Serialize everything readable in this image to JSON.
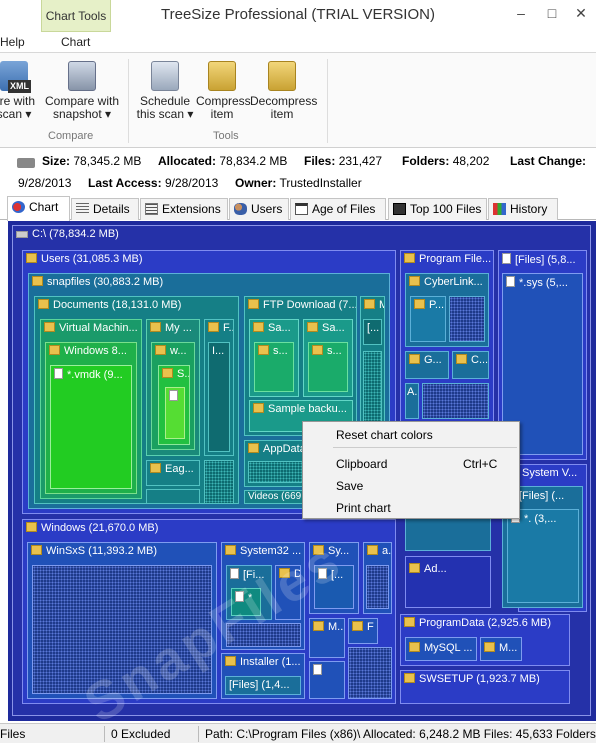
{
  "window": {
    "title": "TreeSize Professional  (TRIAL VERSION)",
    "contextual_tab": "Chart Tools",
    "minimize": "–",
    "maximize": "□",
    "close": "✕"
  },
  "ribbon": {
    "tabs": [
      "Help",
      "Chart"
    ],
    "buttons": {
      "export_xml": "are with\nscan ▾",
      "compare": "Compare with\nsnapshot ▾",
      "schedule": "Schedule\nthis scan ▾",
      "compress": "Compress\nitem",
      "decompress": "Decompress\nitem"
    },
    "groups": {
      "compare": "Compare",
      "tools": "Tools"
    },
    "xml_badge": "XML"
  },
  "info": {
    "size_label": "Size:",
    "size": "78,345.2 MB",
    "allocated_label": "Allocated:",
    "allocated": "78,834.2 MB",
    "files_label": "Files:",
    "files": "231,427",
    "folders_label": "Folders:",
    "folders": "48,202",
    "last_change_label": "Last Change:",
    "last_change": "9/28/2013",
    "last_access_label": "Last Access:",
    "last_access": "9/28/2013",
    "owner_label": "Owner:",
    "owner": "TrustedInstaller"
  },
  "tabs": [
    "Chart",
    "Details",
    "Extensions",
    "Users",
    "Age of Files",
    "Top 100 Files",
    "History"
  ],
  "treemap": {
    "root": "C:\\ (78,834.2 MB)",
    "users": "Users (31,085.3 MB)",
    "snapfiles": "snapfiles (30,883.2 MB)",
    "documents": "Documents (18,131.0 MB)",
    "virtual_machine": "Virtual Machin...",
    "windows8": "Windows 8...",
    "vmdk": "*.vmdk (9...",
    "my": "My ...",
    "w": "w...",
    "s": "S...",
    "f": "F...",
    "i": "I...",
    "eag": "Eag...",
    "ftp": "FTP Download (7...",
    "m1": "M",
    "bracket1": "[...",
    "sa1": "Sa...",
    "sa2": "Sa...",
    "s1": "s...",
    "s2": "s...",
    "sample": "Sample backu...",
    "appdata": "AppData",
    "videos": "Videos (669...",
    "program_files": "Program File...",
    "cyberlink": "CyberLink...",
    "p": "P...",
    "g": "G...",
    "c": "C...",
    "a": "A...",
    "files_top": "[Files] (5,8...",
    "sys": "*.sys (5,...",
    "system_v": "System V...",
    "files_sv": "[Files] (...",
    "star3": "*. (3,...",
    "ad": "Ad...",
    "windows": "Windows (21,670.0 MB)",
    "winsxs": "WinSxS (11,393.2 MB)",
    "system32": "System32 ...",
    "sy": "Sy...",
    "a2": "a...",
    "fi": "[Fi...",
    "d": "D",
    "star": "*",
    "bracket2": "[...",
    "m2": "M...",
    "f2": "F",
    "installer": "Installer (1...",
    "files_inst": "[Files] (1,4...",
    "programdata": "ProgramData (2,925.6 MB)",
    "mysql": "MySQL ...",
    "m3": "M...",
    "swsetup": "SWSETUP (1,923.7 MB)",
    "watermark": "SnapFiles"
  },
  "context_menu": {
    "reset": "Reset chart colors",
    "clipboard": "Clipboard",
    "clipboard_shortcut": "Ctrl+C",
    "save": "Save",
    "print": "Print chart"
  },
  "status": {
    "files": "Files",
    "excluded": "0 Excluded",
    "path": "Path: C:\\Program Files (x86)\\  Allocated: 6,248.2 MB  Files: 45,633  Folders:"
  },
  "colors": {
    "treemap_bg": "#1e2a9c",
    "green": "#28c828",
    "teal": "#0d8a8a",
    "menu_bg": "#f2f2f2"
  }
}
